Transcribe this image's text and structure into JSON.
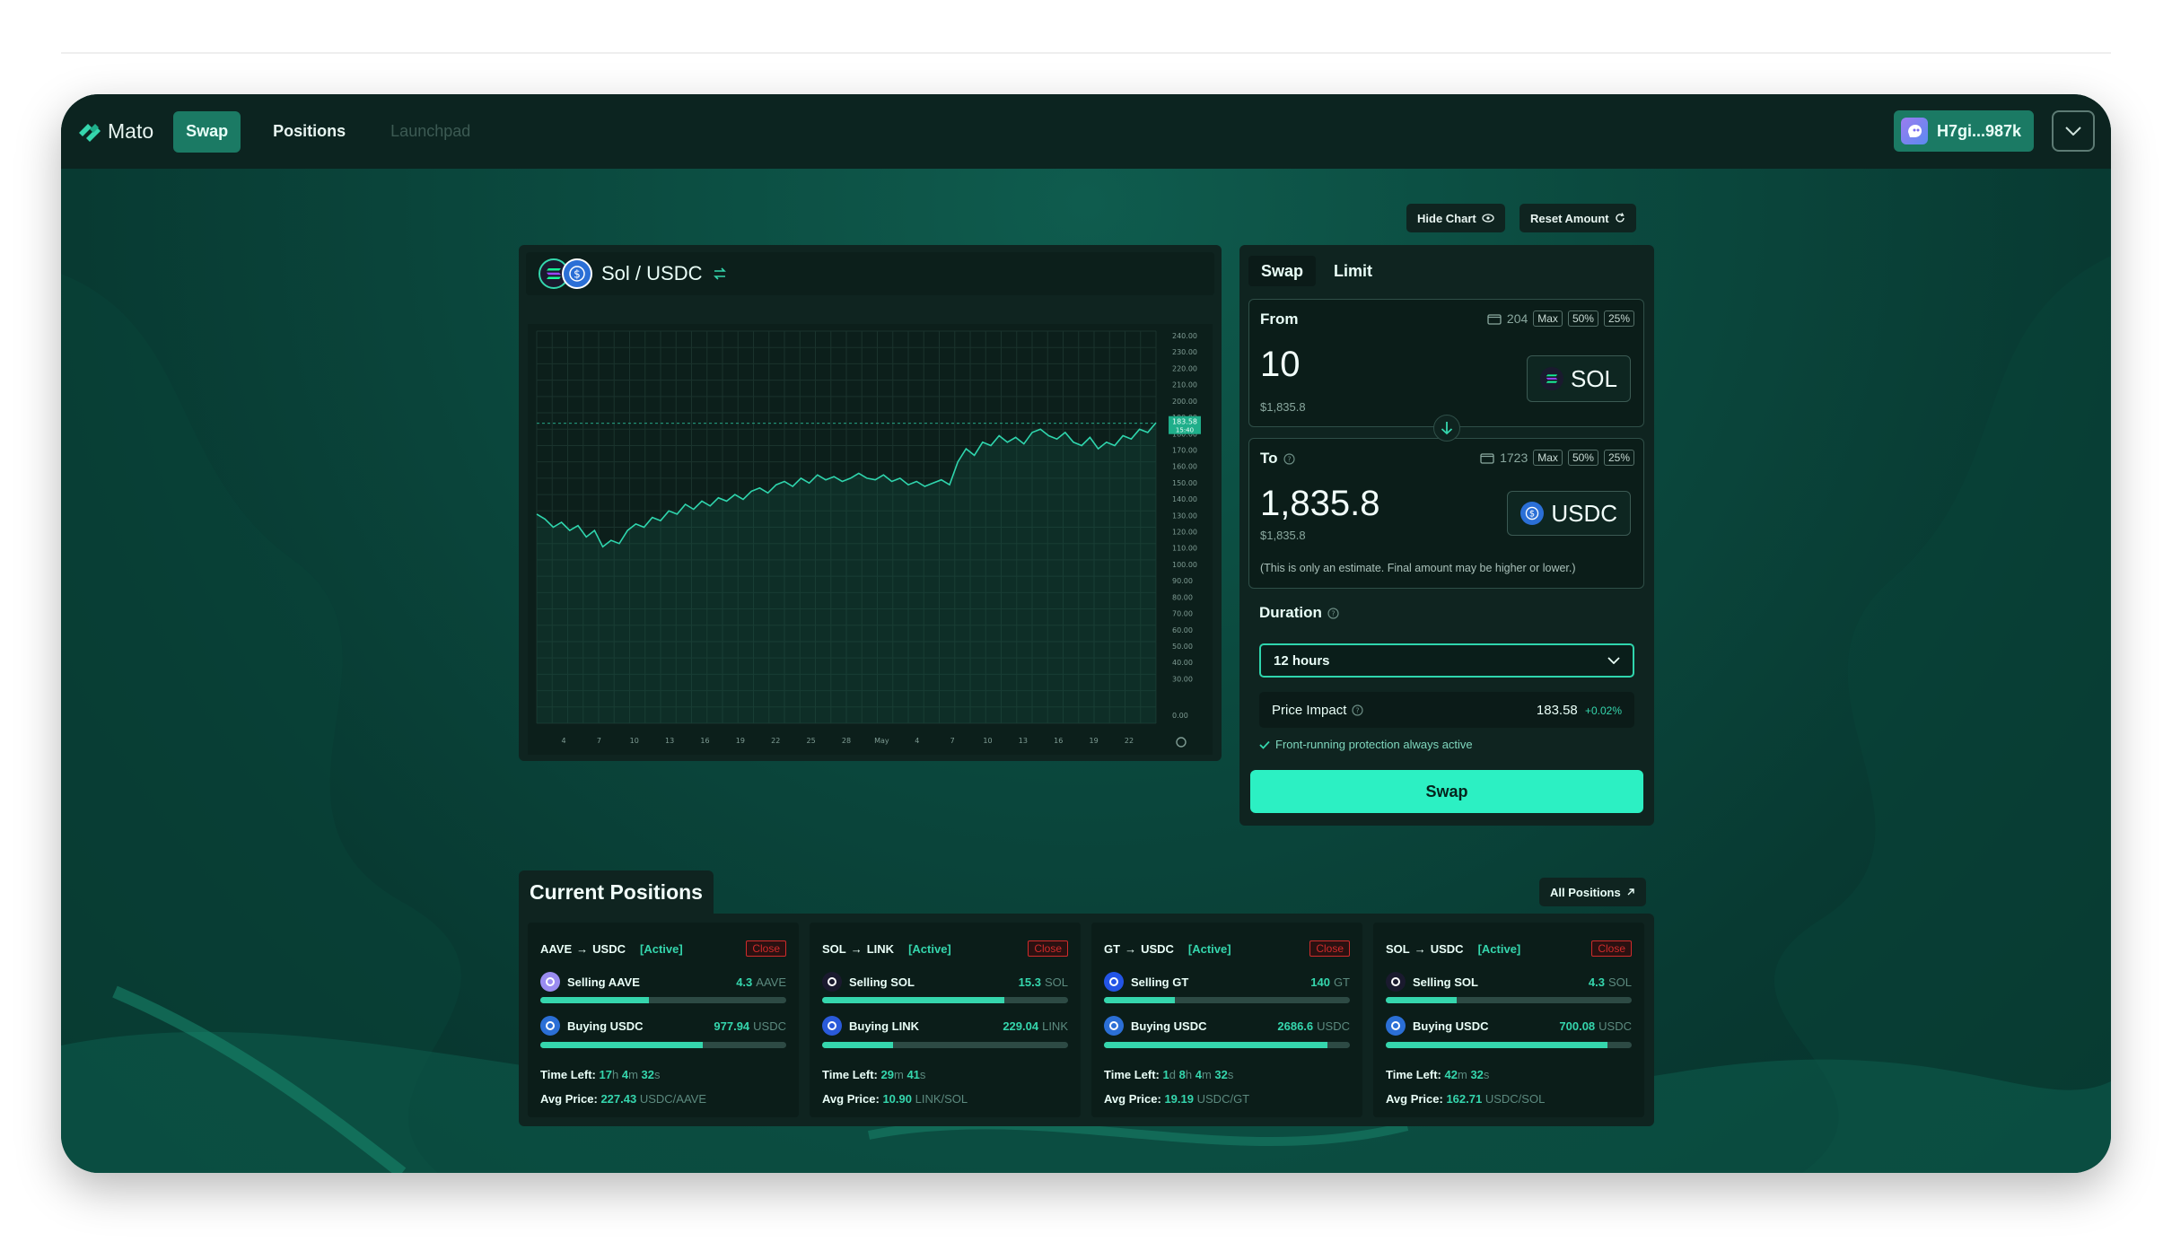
{
  "nav": {
    "brand": "Mato",
    "items": [
      {
        "label": "Swap",
        "state": "active"
      },
      {
        "label": "Positions",
        "state": "plain"
      },
      {
        "label": "Launchpad",
        "state": "disabled"
      }
    ],
    "wallet": "H7gi...987k"
  },
  "toolbar": {
    "hide_chart": "Hide Chart",
    "reset_amount": "Reset Amount"
  },
  "chart": {
    "pair": "Sol / USDC"
  },
  "chart_data": {
    "type": "line",
    "x_ticks": [
      "4",
      "7",
      "10",
      "13",
      "16",
      "19",
      "22",
      "25",
      "28",
      "May",
      "4",
      "7",
      "10",
      "13",
      "16",
      "19",
      "22"
    ],
    "y_ticks": [
      "240.00",
      "230.00",
      "220.00",
      "210.00",
      "200.00",
      "190.00",
      "180.00",
      "170.00",
      "160.00",
      "150.00",
      "140.00",
      "130.00",
      "120.00",
      "110.00",
      "100.00",
      "90.00",
      "80.00",
      "70.00",
      "60.00",
      "50.00",
      "40.00",
      "30.00",
      "0.00"
    ],
    "last_price": "183.58",
    "last_time": "15:40",
    "ylim": [
      0,
      240
    ],
    "grid": true,
    "values": [
      128,
      125,
      120,
      123,
      118,
      121,
      114,
      118,
      108,
      112,
      110,
      118,
      122,
      120,
      126,
      124,
      130,
      128,
      134,
      131,
      136,
      133,
      138,
      136,
      140,
      137,
      142,
      144,
      141,
      146,
      148,
      145,
      150,
      147,
      152,
      149,
      151,
      148,
      150,
      153,
      150,
      149,
      152,
      148,
      150,
      146,
      148,
      145,
      147,
      149,
      146,
      160,
      168,
      164,
      172,
      170,
      176,
      172,
      175,
      171,
      178,
      180,
      176,
      174,
      178,
      172,
      170,
      175,
      168,
      172,
      170,
      176,
      174,
      180,
      178,
      184
    ]
  },
  "swap": {
    "tabs": [
      "Swap",
      "Limit"
    ],
    "from": {
      "label": "From",
      "balance": "204",
      "max": "Max",
      "p50": "50%",
      "p25": "25%",
      "amount": "10",
      "usd": "$1,835.8",
      "token": "SOL"
    },
    "to": {
      "label": "To",
      "balance": "1723",
      "max": "Max",
      "p50": "50%",
      "p25": "25%",
      "amount": "1,835.8",
      "usd": "$1,835.8",
      "token": "USDC",
      "note": "(This is only an estimate. Final amount may be higher or lower.)"
    },
    "duration_label": "Duration",
    "duration_value": "12 hours",
    "price_impact_label": "Price Impact",
    "price_impact_value": "183.58",
    "price_impact_change": "+0.02%",
    "protection": "Front-running protection always active",
    "cta": "Swap"
  },
  "positions": {
    "title": "Current Positions",
    "all_label": "All Positions",
    "cards": [
      {
        "from": "AAVE",
        "to": "USDC",
        "status": "[Active]",
        "close": "Close",
        "sell_label": "Selling AAVE",
        "sell_amount": "4.3",
        "sell_unit": "AAVE",
        "sell_progress": 0.44,
        "sell_color": "#9a8cf0",
        "buy_label": "Buying USDC",
        "buy_amount": "977.94",
        "buy_unit": "USDC",
        "buy_progress": 0.66,
        "buy_color": "#2b6fd6",
        "time_label": "Time Left:",
        "time_parts": [
          [
            "17",
            "h"
          ],
          [
            "4",
            "m"
          ],
          [
            "32",
            "s"
          ]
        ],
        "avg_label": "Avg Price:",
        "avg_value": "227.43",
        "avg_unit": "USDC/AAVE"
      },
      {
        "from": "SOL",
        "to": "LINK",
        "status": "[Active]",
        "close": "Close",
        "sell_label": "Selling SOL",
        "sell_amount": "15.3",
        "sell_unit": "SOL",
        "sell_progress": 0.74,
        "sell_color": "#1a1a2e",
        "buy_label": "Buying LINK",
        "buy_amount": "229.04",
        "buy_unit": "LINK",
        "buy_progress": 0.29,
        "buy_color": "#2a5ada",
        "time_label": "Time Left:",
        "time_parts": [
          [
            "29",
            "m"
          ],
          [
            "41",
            "s"
          ]
        ],
        "avg_label": "Avg Price:",
        "avg_value": "10.90",
        "avg_unit": "LINK/SOL"
      },
      {
        "from": "GT",
        "to": "USDC",
        "status": "[Active]",
        "close": "Close",
        "sell_label": "Selling GT",
        "sell_amount": "140",
        "sell_unit": "GT",
        "sell_progress": 0.29,
        "sell_color": "#2354e6",
        "buy_label": "Buying USDC",
        "buy_amount": "2686.6",
        "buy_unit": "USDC",
        "buy_progress": 0.91,
        "buy_color": "#2b6fd6",
        "time_label": "Time Left:",
        "time_parts": [
          [
            "1",
            "d"
          ],
          [
            "8",
            "h"
          ],
          [
            "4",
            "m"
          ],
          [
            "32",
            "s"
          ]
        ],
        "avg_label": "Avg Price:",
        "avg_value": "19.19",
        "avg_unit": "USDC/GT"
      },
      {
        "from": "SOL",
        "to": "USDC",
        "status": "[Active]",
        "close": "Close",
        "sell_label": "Selling SOL",
        "sell_amount": "4.3",
        "sell_unit": "SOL",
        "sell_progress": 0.29,
        "sell_color": "#1a1a2e",
        "buy_label": "Buying USDC",
        "buy_amount": "700.08",
        "buy_unit": "USDC",
        "buy_progress": 0.9,
        "buy_color": "#2b6fd6",
        "time_label": "Time Left:",
        "time_parts": [
          [
            "42",
            "m"
          ],
          [
            "32",
            "s"
          ]
        ],
        "avg_label": "Avg Price:",
        "avg_value": "162.71",
        "avg_unit": "USDC/SOL"
      }
    ]
  },
  "colors": {
    "accent": "#2cf0c3",
    "brand": "#1b7a64",
    "panel": "#0f2420",
    "danger": "#d02b2b",
    "positive": "#35d6ad"
  }
}
